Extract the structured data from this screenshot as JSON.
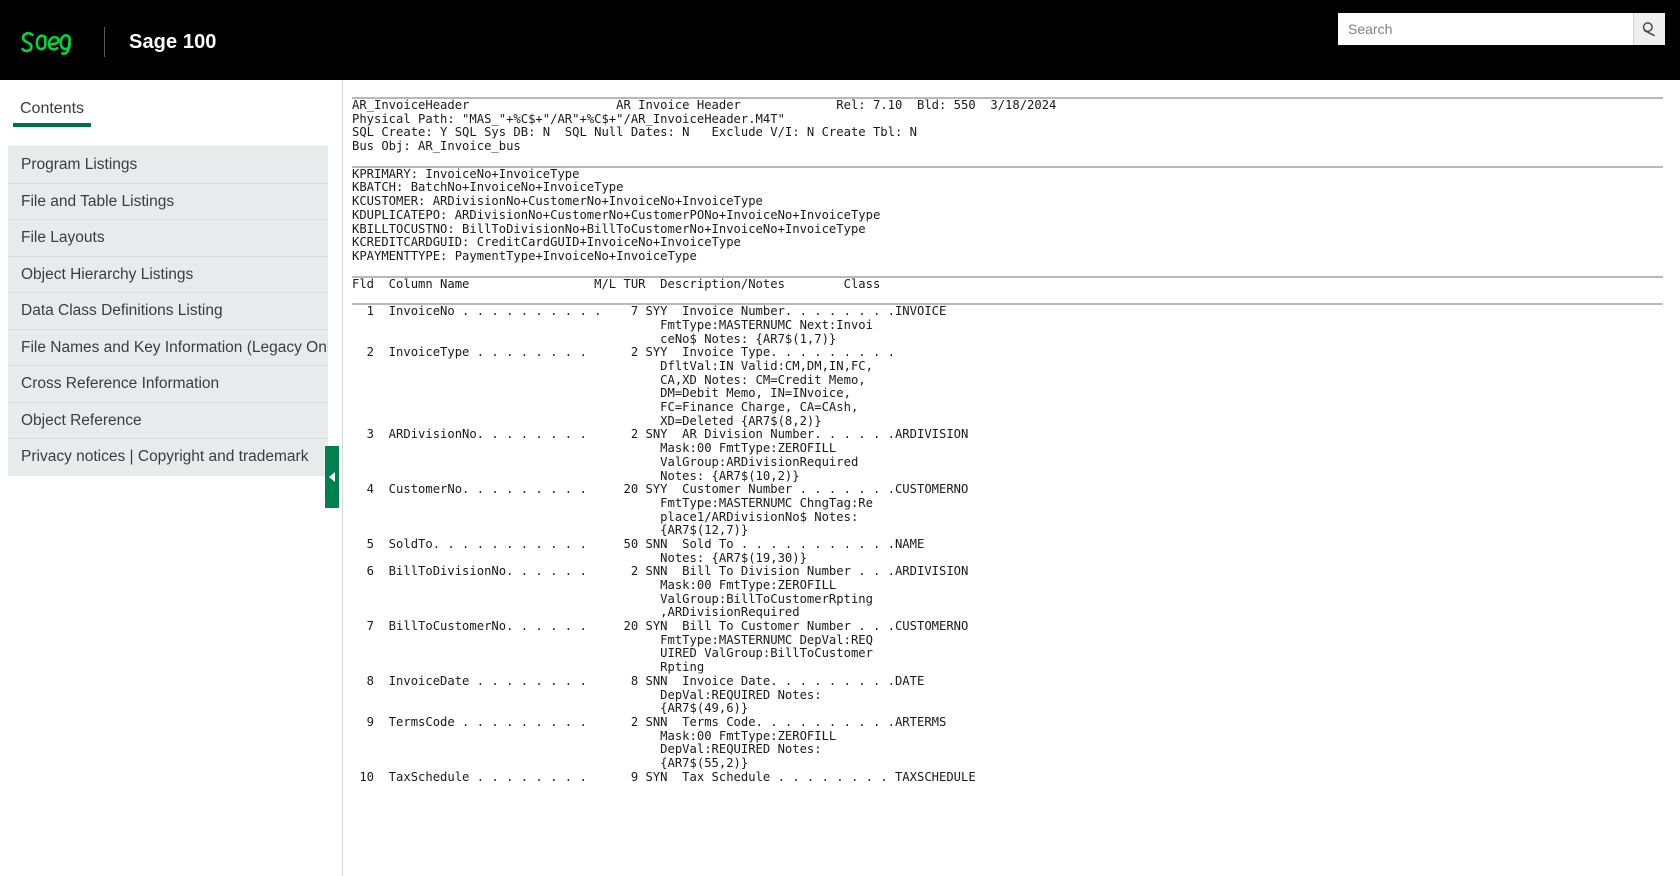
{
  "header": {
    "logo_name": "sage-logo",
    "brand_title": "Sage 100",
    "search": {
      "placeholder": "Search",
      "value": "",
      "icon": "search-icon"
    }
  },
  "sidebar": {
    "tab_label": "Contents",
    "items": [
      {
        "label": "Program Listings"
      },
      {
        "label": "File and Table Listings"
      },
      {
        "label": "File Layouts"
      },
      {
        "label": "Object Hierarchy Listings"
      },
      {
        "label": "Data Class Definitions Listing"
      },
      {
        "label": "File Names and Key Information (Legacy Only)"
      },
      {
        "label": "Cross Reference Information"
      },
      {
        "label": "Object Reference"
      },
      {
        "label": "Privacy notices | Copyright and trademark"
      }
    ],
    "collapse_handle_icon": "chevron-left-icon"
  },
  "document": {
    "file_header": "AR_InvoiceHeader                    AR Invoice Header             Rel: 7.10  Bld: 550  3/18/2024\nPhysical Path: \"MAS_\"+%C$+\"/AR\"+%C$+\"/AR_InvoiceHeader.M4T\"\nSQL Create: Y SQL Sys DB: N  SQL Null Dates: N   Exclude V/I: N Create Tbl: N\nBus Obj: AR_Invoice_bus",
    "keys": "KPRIMARY: InvoiceNo+InvoiceType\nKBATCH: BatchNo+InvoiceNo+InvoiceType\nKCUSTOMER: ARDivisionNo+CustomerNo+InvoiceNo+InvoiceType\nKDUPLICATEPO: ARDivisionNo+CustomerNo+CustomerPONo+InvoiceNo+InvoiceType\nKBILLTOCUSTNO: BillToDivisionNo+BillToCustomerNo+InvoiceNo+InvoiceType\nKCREDITCARDGUID: CreditCardGUID+InvoiceNo+InvoiceType\nKPAYMENTTYPE: PaymentType+InvoiceNo+InvoiceType",
    "column_header": "Fld  Column Name                 M/L TUR  Description/Notes        Class",
    "rows": "  1  InvoiceNo . . . . . . . . . .    7 SYY  Invoice Number. . . . . . . .INVOICE\n                                          FmtType:MASTERNUMC Next:Invoi\n                                          ceNo$ Notes: {AR7$(1,7)}\n  2  InvoiceType . . . . . . . .      2 SYY  Invoice Type. . . . . . . . .\n                                          DfltVal:IN Valid:CM,DM,IN,FC,\n                                          CA,XD Notes: CM=Credit Memo,\n                                          DM=Debit Memo, IN=INvoice,\n                                          FC=Finance Charge, CA=CAsh,\n                                          XD=Deleted {AR7$(8,2)}\n  3  ARDivisionNo. . . . . . . .      2 SNY  AR Division Number. . . . . .ARDIVISION\n                                          Mask:00 FmtType:ZEROFILL\n                                          ValGroup:ARDivisionRequired\n                                          Notes: {AR7$(10,2)}\n  4  CustomerNo. . . . . . . . .     20 SYY  Customer Number . . . . . . .CUSTOMERNO\n                                          FmtType:MASTERNUMC ChngTag:Re\n                                          place1/ARDivisionNo$ Notes:\n                                          {AR7$(12,7)}\n  5  SoldTo. . . . . . . . . . .     50 SNN  Sold To . . . . . . . . . . .NAME\n                                          Notes: {AR7$(19,30)}\n  6  BillToDivisionNo. . . . . .      2 SNN  Bill To Division Number . . .ARDIVISION\n                                          Mask:00 FmtType:ZEROFILL\n                                          ValGroup:BillToCustomerRpting\n                                          ,ARDivisionRequired\n  7  BillToCustomerNo. . . . . .     20 SYN  Bill To Customer Number . . .CUSTOMERNO\n                                          FmtType:MASTERNUMC DepVal:REQ\n                                          UIRED ValGroup:BillToCustomer\n                                          Rpting\n  8  InvoiceDate . . . . . . . .      8 SNN  Invoice Date. . . . . . . . .DATE\n                                          DepVal:REQUIRED Notes:\n                                          {AR7$(49,6)}\n  9  TermsCode . . . . . . . . .      2 SNN  Terms Code. . . . . . . . . .ARTERMS\n                                          Mask:00 FmtType:ZEROFILL\n                                          DepVal:REQUIRED Notes:\n                                          {AR7$(55,2)}\n 10  TaxSchedule . . . . . . . .      9 SYN  Tax Schedule . . . . . . . . TAXSCHEDULE"
  },
  "colors": {
    "brand_green": "#00704a",
    "handle_green": "#00804f",
    "topbar_black": "#000000",
    "sidebar_gray": "#e8ebec"
  }
}
